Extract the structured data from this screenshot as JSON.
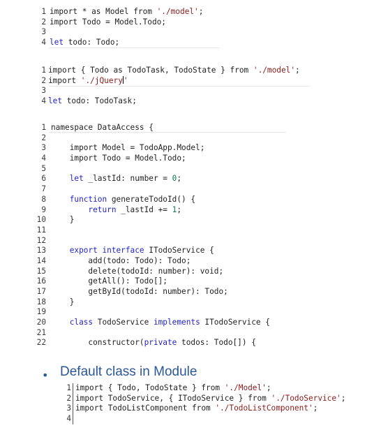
{
  "snippets": [
    {
      "lines": [
        {
          "n": "1",
          "parts": [
            [
              "t",
              "import * as Model from "
            ],
            [
              "s",
              "'./model'"
            ],
            [
              "t",
              ";"
            ]
          ]
        },
        {
          "n": "2",
          "parts": [
            [
              "t",
              "import Todo = Model.Todo;"
            ]
          ]
        },
        {
          "n": "3",
          "parts": []
        },
        {
          "n": "4",
          "parts": [
            [
              "k",
              "let"
            ],
            [
              "t",
              " todo: Todo;"
            ]
          ]
        }
      ]
    },
    {
      "lines": [
        {
          "n": "1",
          "parts": [
            [
              "t",
              "import { Todo as TodoTask, TodoState } from "
            ],
            [
              "s",
              "'./model'"
            ],
            [
              "t",
              ";"
            ]
          ]
        },
        {
          "n": "2",
          "parts": [
            [
              "t",
              "import "
            ],
            [
              "s",
              "'./jQuery"
            ],
            [
              "c",
              ""
            ],
            [
              "s",
              "'"
            ]
          ]
        },
        {
          "n": "3",
          "parts": []
        },
        {
          "n": "4",
          "parts": [
            [
              "k",
              "let"
            ],
            [
              "t",
              " todo: TodoTask;"
            ]
          ]
        }
      ]
    },
    {
      "lines": [
        {
          "n": "1",
          "parts": [
            [
              "t",
              "namespace DataAccess {"
            ]
          ]
        },
        {
          "n": "2",
          "parts": []
        },
        {
          "n": "3",
          "parts": [
            [
              "t",
              "    import Model = TodoApp.Model;"
            ]
          ]
        },
        {
          "n": "4",
          "parts": [
            [
              "t",
              "    import Todo = Model.Todo;"
            ]
          ]
        },
        {
          "n": "5",
          "parts": []
        },
        {
          "n": "6",
          "parts": [
            [
              "k",
              "    let"
            ],
            [
              "t",
              " _lastId: number = "
            ],
            [
              "n",
              "0"
            ],
            [
              "t",
              ";"
            ]
          ]
        },
        {
          "n": "7",
          "parts": []
        },
        {
          "n": "8",
          "parts": [
            [
              "k",
              "    function"
            ],
            [
              "t",
              " generateTodoId() {"
            ]
          ]
        },
        {
          "n": "9",
          "parts": [
            [
              "k",
              "        return"
            ],
            [
              "t",
              " _lastId += "
            ],
            [
              "n",
              "1"
            ],
            [
              "t",
              ";"
            ]
          ]
        },
        {
          "n": "10",
          "parts": [
            [
              "t",
              "    }"
            ]
          ]
        },
        {
          "n": "11",
          "parts": []
        },
        {
          "n": "12",
          "parts": []
        },
        {
          "n": "13",
          "parts": [
            [
              "k",
              "    export interface"
            ],
            [
              "t",
              " ITodoService {"
            ]
          ]
        },
        {
          "n": "14",
          "parts": [
            [
              "t",
              "        add(todo: Todo): Todo;"
            ]
          ]
        },
        {
          "n": "15",
          "parts": [
            [
              "t",
              "        delete(todoId: number): void;"
            ]
          ]
        },
        {
          "n": "16",
          "parts": [
            [
              "t",
              "        getAll(): Todo[];"
            ]
          ]
        },
        {
          "n": "17",
          "parts": [
            [
              "t",
              "        getById(todoId: number): Todo;"
            ]
          ]
        },
        {
          "n": "18",
          "parts": [
            [
              "t",
              "    }"
            ]
          ]
        },
        {
          "n": "19",
          "parts": []
        },
        {
          "n": "20",
          "parts": [
            [
              "k",
              "    class"
            ],
            [
              "t",
              " TodoService "
            ],
            [
              "k",
              "implements"
            ],
            [
              "t",
              " ITodoService {"
            ]
          ]
        },
        {
          "n": "21",
          "parts": []
        },
        {
          "n": "22",
          "parts": [
            [
              "t",
              "        constructor("
            ],
            [
              "k",
              "private"
            ],
            [
              "t",
              " todos: Todo[]) {"
            ]
          ]
        }
      ]
    },
    {
      "lines": [
        {
          "n": "1",
          "parts": [
            [
              "t",
              "import { Todo, TodoState } from "
            ],
            [
              "s",
              "'./Model'"
            ],
            [
              "t",
              ";"
            ]
          ]
        },
        {
          "n": "2",
          "parts": [
            [
              "t",
              "import TodoService, { ITodoService } from "
            ],
            [
              "s",
              "'./TodoService'"
            ],
            [
              "t",
              ";"
            ]
          ]
        },
        {
          "n": "3",
          "parts": [
            [
              "t",
              "import TodoListComponent from "
            ],
            [
              "s",
              "'./TodoListComponent'"
            ],
            [
              "t",
              ";"
            ]
          ]
        },
        {
          "n": "4",
          "parts": []
        }
      ]
    }
  ],
  "bullet": {
    "marker": "•",
    "text": "Default class in Module"
  }
}
